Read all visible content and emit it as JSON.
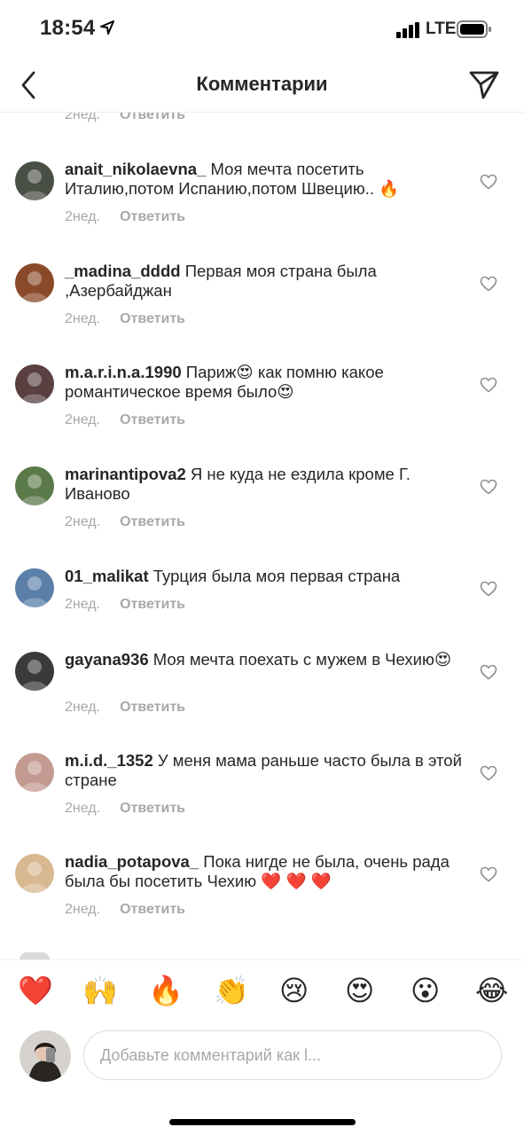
{
  "status": {
    "time": "18:54",
    "network": "LTE"
  },
  "header": {
    "title": "Комментарии"
  },
  "top_partial": {
    "time": "2нед.",
    "reply_label": "Ответить"
  },
  "comments": [
    {
      "user": "anait_nikolaevna_",
      "parts": [
        "Моя мечта посетить Италию,потом Испанию,потом Швецию.. ",
        "🔥"
      ],
      "time": "2нед.",
      "reply_label": "Ответить",
      "avatar_color": "#4a4f45"
    },
    {
      "user": "_madina_dddd",
      "parts": [
        "Первая моя страна была ,Азербайджан"
      ],
      "time": "2нед.",
      "reply_label": "Ответить",
      "avatar_color": "#8a4a2a"
    },
    {
      "user": "m.a.r.i.n.a.1990",
      "parts": [
        "Париж",
        "😍",
        " как помню какое романтическое время было",
        "😍"
      ],
      "time": "2нед.",
      "reply_label": "Ответить",
      "avatar_color": "#5a4040"
    },
    {
      "user": "marinantipova2",
      "parts": [
        "Я не куда  не ездила  кроме Г. Иваново"
      ],
      "time": "2нед.",
      "reply_label": "Ответить",
      "avatar_color": "#5b7a4a"
    },
    {
      "user": "01_malikat",
      "parts": [
        "Турция была моя первая страна"
      ],
      "time": "2нед.",
      "reply_label": "Ответить",
      "avatar_color": "#5a7fa8"
    },
    {
      "user": "gayana936",
      "parts": [
        "Моя мечта поехать с мужем в Чехию",
        "😍"
      ],
      "time": "2нед.",
      "reply_label": "Ответить",
      "avatar_color": "#3a3a3a"
    },
    {
      "user": "m.i.d._1352",
      "parts": [
        "У меня мама раньше часто была в этой стране"
      ],
      "time": "2нед.",
      "reply_label": "Ответить",
      "avatar_color": "#c49a90"
    },
    {
      "user": "nadia_potapova_",
      "parts": [
        "Пока нигде не была, очень рада была бы посетить Чехию ",
        "❤️",
        " ",
        "❤️",
        " ",
        "❤️"
      ],
      "time": "2нед.",
      "reply_label": "Ответить",
      "avatar_color": "#d8b890"
    }
  ],
  "reactions": [
    "❤️",
    "🙌",
    "🔥",
    "👏",
    "😢",
    "😍",
    "😮",
    "😂"
  ],
  "composer": {
    "placeholder": "Добавьте комментарий как l..."
  },
  "colors": {
    "text": "#262626",
    "muted": "#a8a8a8",
    "border": "#dbdbdb"
  }
}
